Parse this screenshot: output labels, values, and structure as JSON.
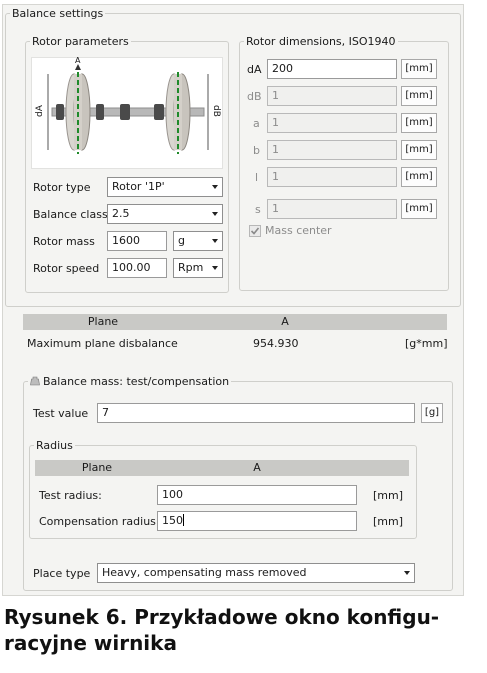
{
  "balance_settings": {
    "title": "Balance settings"
  },
  "rotor_parameters": {
    "title": "Rotor parameters",
    "image": {
      "label_left": "dA",
      "label_right": "dB",
      "top_mark": "A"
    },
    "rotor_type": {
      "label": "Rotor type",
      "value": "Rotor '1P'"
    },
    "balance_class": {
      "label": "Balance class",
      "value": "2.5"
    },
    "rotor_mass": {
      "label": "Rotor mass",
      "value": "1600",
      "unit": "g"
    },
    "rotor_speed": {
      "label": "Rotor speed",
      "value": "100.00",
      "unit": "Rpm"
    }
  },
  "rotor_dimensions": {
    "title": "Rotor dimensions, ISO1940",
    "rows": [
      {
        "label": "dA",
        "value": "200",
        "unit": "[mm]",
        "enabled": true
      },
      {
        "label": "dB",
        "value": "1",
        "unit": "[mm]",
        "enabled": false
      },
      {
        "label": "a",
        "value": "1",
        "unit": "[mm]",
        "enabled": false
      },
      {
        "label": "b",
        "value": "1",
        "unit": "[mm]",
        "enabled": false
      },
      {
        "label": "l",
        "value": "1",
        "unit": "[mm]",
        "enabled": false
      },
      {
        "label": "s",
        "value": "1",
        "unit": "[mm]",
        "enabled": false
      }
    ],
    "mass_center": {
      "label": "Mass center",
      "checked": true
    }
  },
  "disbalance_table": {
    "headers": [
      "Plane",
      "A"
    ],
    "row": {
      "label": "Maximum plane disbalance",
      "value": "954.930",
      "unit": "[g*mm]"
    }
  },
  "balance_mass": {
    "title": "Balance mass: test/compensation",
    "test_value": {
      "label": "Test value",
      "value": "7",
      "unit": "[g]"
    },
    "radius": {
      "title": "Radius",
      "headers": [
        "Plane",
        "A"
      ],
      "test_radius": {
        "label": "Test radius:",
        "value": "100",
        "unit": "[mm]"
      },
      "compensation_radius": {
        "label": "Compensation radius",
        "value": "150",
        "unit": "[mm]"
      }
    },
    "place_type": {
      "label": "Place type",
      "value": "Heavy, compensating mass removed"
    }
  },
  "caption": "Rysunek 6. Przykładowe okno konfiguracyjne wirnika",
  "caption_lines": [
    "Rysunek 6. Przykładowe okno konfigu-",
    "racyjne wirnika"
  ]
}
